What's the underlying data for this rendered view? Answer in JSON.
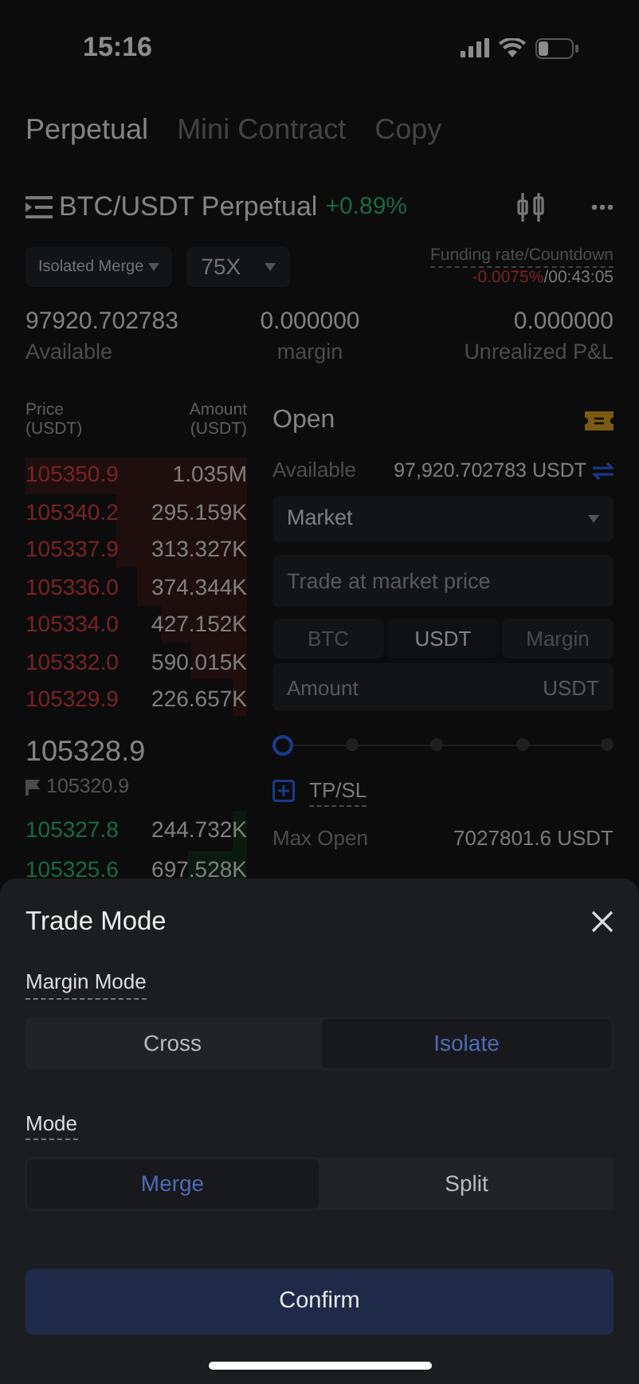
{
  "status_bar": {
    "time": "15:16"
  },
  "tabs": [
    {
      "label": "Perpetual",
      "selected": true
    },
    {
      "label": "Mini Contract",
      "selected": false
    },
    {
      "label": "Copy",
      "selected": false
    }
  ],
  "header": {
    "pair": "BTC/USDT Perpetual",
    "change": "+0.89%"
  },
  "controls": {
    "margin_mode": "Isolated Merge",
    "leverage": "75X",
    "funding_label": "Funding rate/Countdown",
    "funding_rate": "-0.0075%",
    "countdown": "/00:43:05"
  },
  "stats": [
    {
      "value": "97920.702783",
      "label": "Available"
    },
    {
      "value": "0.000000",
      "label": "margin"
    },
    {
      "value": "0.000000",
      "label": "Unrealized P&L"
    }
  ],
  "order_book": {
    "price_header": "Price\n(USDT)",
    "amount_header": "Amount\n(USDT)",
    "asks": [
      {
        "price": "105350.9",
        "amount": "1.035M"
      },
      {
        "price": "105340.2",
        "amount": "295.159K"
      },
      {
        "price": "105337.9",
        "amount": "313.327K"
      },
      {
        "price": "105336.0",
        "amount": "374.344K"
      },
      {
        "price": "105334.0",
        "amount": "427.152K"
      },
      {
        "price": "105332.0",
        "amount": "590.015K"
      },
      {
        "price": "105329.9",
        "amount": "226.657K"
      }
    ],
    "last_price": "105328.9",
    "mark_price": "105320.9",
    "bids": [
      {
        "price": "105327.8",
        "amount": "244.732K"
      },
      {
        "price": "105325.6",
        "amount": "697.528K"
      }
    ]
  },
  "order_form": {
    "title": "Open",
    "available_label": "Available",
    "available_value": "97,920.702783 USDT",
    "order_type": "Market",
    "price_placeholder": "Trade at market price",
    "units": [
      {
        "label": "BTC",
        "selected": false
      },
      {
        "label": "USDT",
        "selected": true
      },
      {
        "label": "Margin",
        "selected": false
      }
    ],
    "amount_placeholder": "Amount",
    "amount_unit": "USDT",
    "slider": {
      "level": 0
    },
    "tpsl": {
      "label": "TP/SL"
    },
    "max_open_label": "Max Open",
    "max_open_value": "7027801.6 USDT"
  },
  "sheet": {
    "title": "Trade Mode",
    "sections": [
      {
        "label": "Margin Mode",
        "options": [
          {
            "label": "Cross",
            "selected": false
          },
          {
            "label": "Isolate",
            "selected": true
          }
        ]
      },
      {
        "label": "Mode",
        "options": [
          {
            "label": "Merge",
            "selected": true
          },
          {
            "label": "Split",
            "selected": false
          }
        ]
      }
    ],
    "confirm": "Confirm"
  }
}
